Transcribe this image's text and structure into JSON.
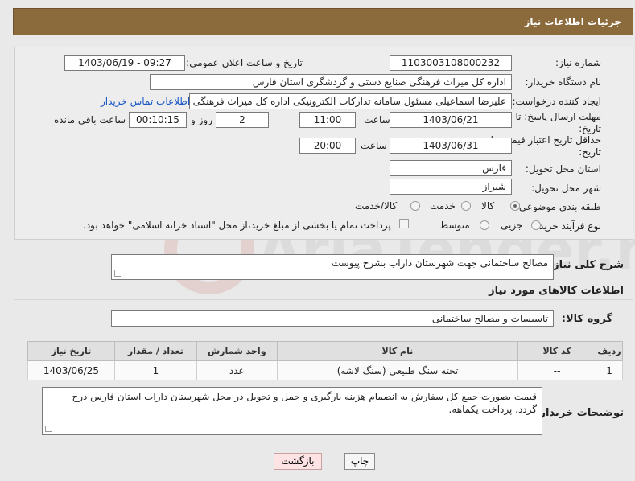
{
  "header": {
    "title": "جزئیات اطلاعات نیاز"
  },
  "form": {
    "need_number_label": "شماره نیاز:",
    "need_number": "1103003108000232",
    "announce_label": "تاریخ و ساعت اعلان عمومی:",
    "announce_value": "1403/06/19 - 09:27",
    "buyer_label": "نام دستگاه خریدار:",
    "buyer_value": "اداره کل میراث فرهنگی  صنایع دستی و گردشگری استان فارس",
    "creator_label": "ایجاد کننده درخواست:",
    "creator_value": "علیرضا اسماعیلی مسئول سامانه تدارکات الکترونیکی اداره کل میراث فرهنگی  صنایع دستی و گردشگری استان فارس",
    "contact_link": "اطلاعات تماس خریدار",
    "deadline_label_line1": "مهلت ارسال پاسخ: تا",
    "deadline_label_line2": "تاریخ:",
    "deadline_date": "1403/06/21",
    "time_label": "ساعت",
    "deadline_time": "11:00",
    "days_value": "2",
    "days_label": "روز و",
    "remaining_value": "00:10:15",
    "remaining_label": "ساعت باقی مانده",
    "validity_label_line1": "حداقل تاریخ اعتبار قیمت: تا",
    "validity_label_line2": "تاریخ:",
    "validity_date": "1403/06/31",
    "validity_time": "20:00",
    "province_label": "استان محل تحویل:",
    "province_value": "فارس",
    "city_label": "شهر محل تحویل:",
    "city_value": "شیراز",
    "category_label": "طبقه بندی موضوعی:",
    "category_options": [
      "کالا",
      "خدمت",
      "کالا/خدمت"
    ],
    "category_selected": "کالا",
    "process_label": "نوع فرآیند خرید :",
    "process_options": [
      "جزیی",
      "متوسط"
    ],
    "payment_note": "پرداخت تمام یا بخشی از مبلغ خرید،از محل \"اسناد خزانه اسلامی\" خواهد بود."
  },
  "description": {
    "label": "شرح کلی نیاز:",
    "value": "مصالح ساختمانی جهت شهرستان داراب بشرح پیوست"
  },
  "goods": {
    "section_title": "اطلاعات کالاهای مورد نیاز",
    "group_label": "گروه کالا:",
    "group_value": "تاسیسات و مصالح ساختمانی",
    "columns": [
      "ردیف",
      "کد کالا",
      "نام کالا",
      "واحد شمارش",
      "تعداد / مقدار",
      "تاریخ نیاز"
    ],
    "rows": [
      {
        "row": "1",
        "code": "--",
        "name": "تخته سنگ طبیعی (سنگ لاشه)",
        "unit": "عدد",
        "qty": "1",
        "date": "1403/06/25"
      }
    ]
  },
  "buyer_notes": {
    "label": "توضیحات خریدار:",
    "value": "قیمت بصورت جمع کل سفارش به انضمام هزینه بارگیری و حمل و تحویل در محل شهرستان داراب استان فارس درج گردد. پرداخت یکماهه."
  },
  "buttons": {
    "print": "چاپ",
    "back": "بازگشت"
  },
  "watermark": {
    "text": "AriaTender.neT"
  },
  "colors": {
    "header": "#8b6a3c",
    "link": "#1a56c4"
  }
}
